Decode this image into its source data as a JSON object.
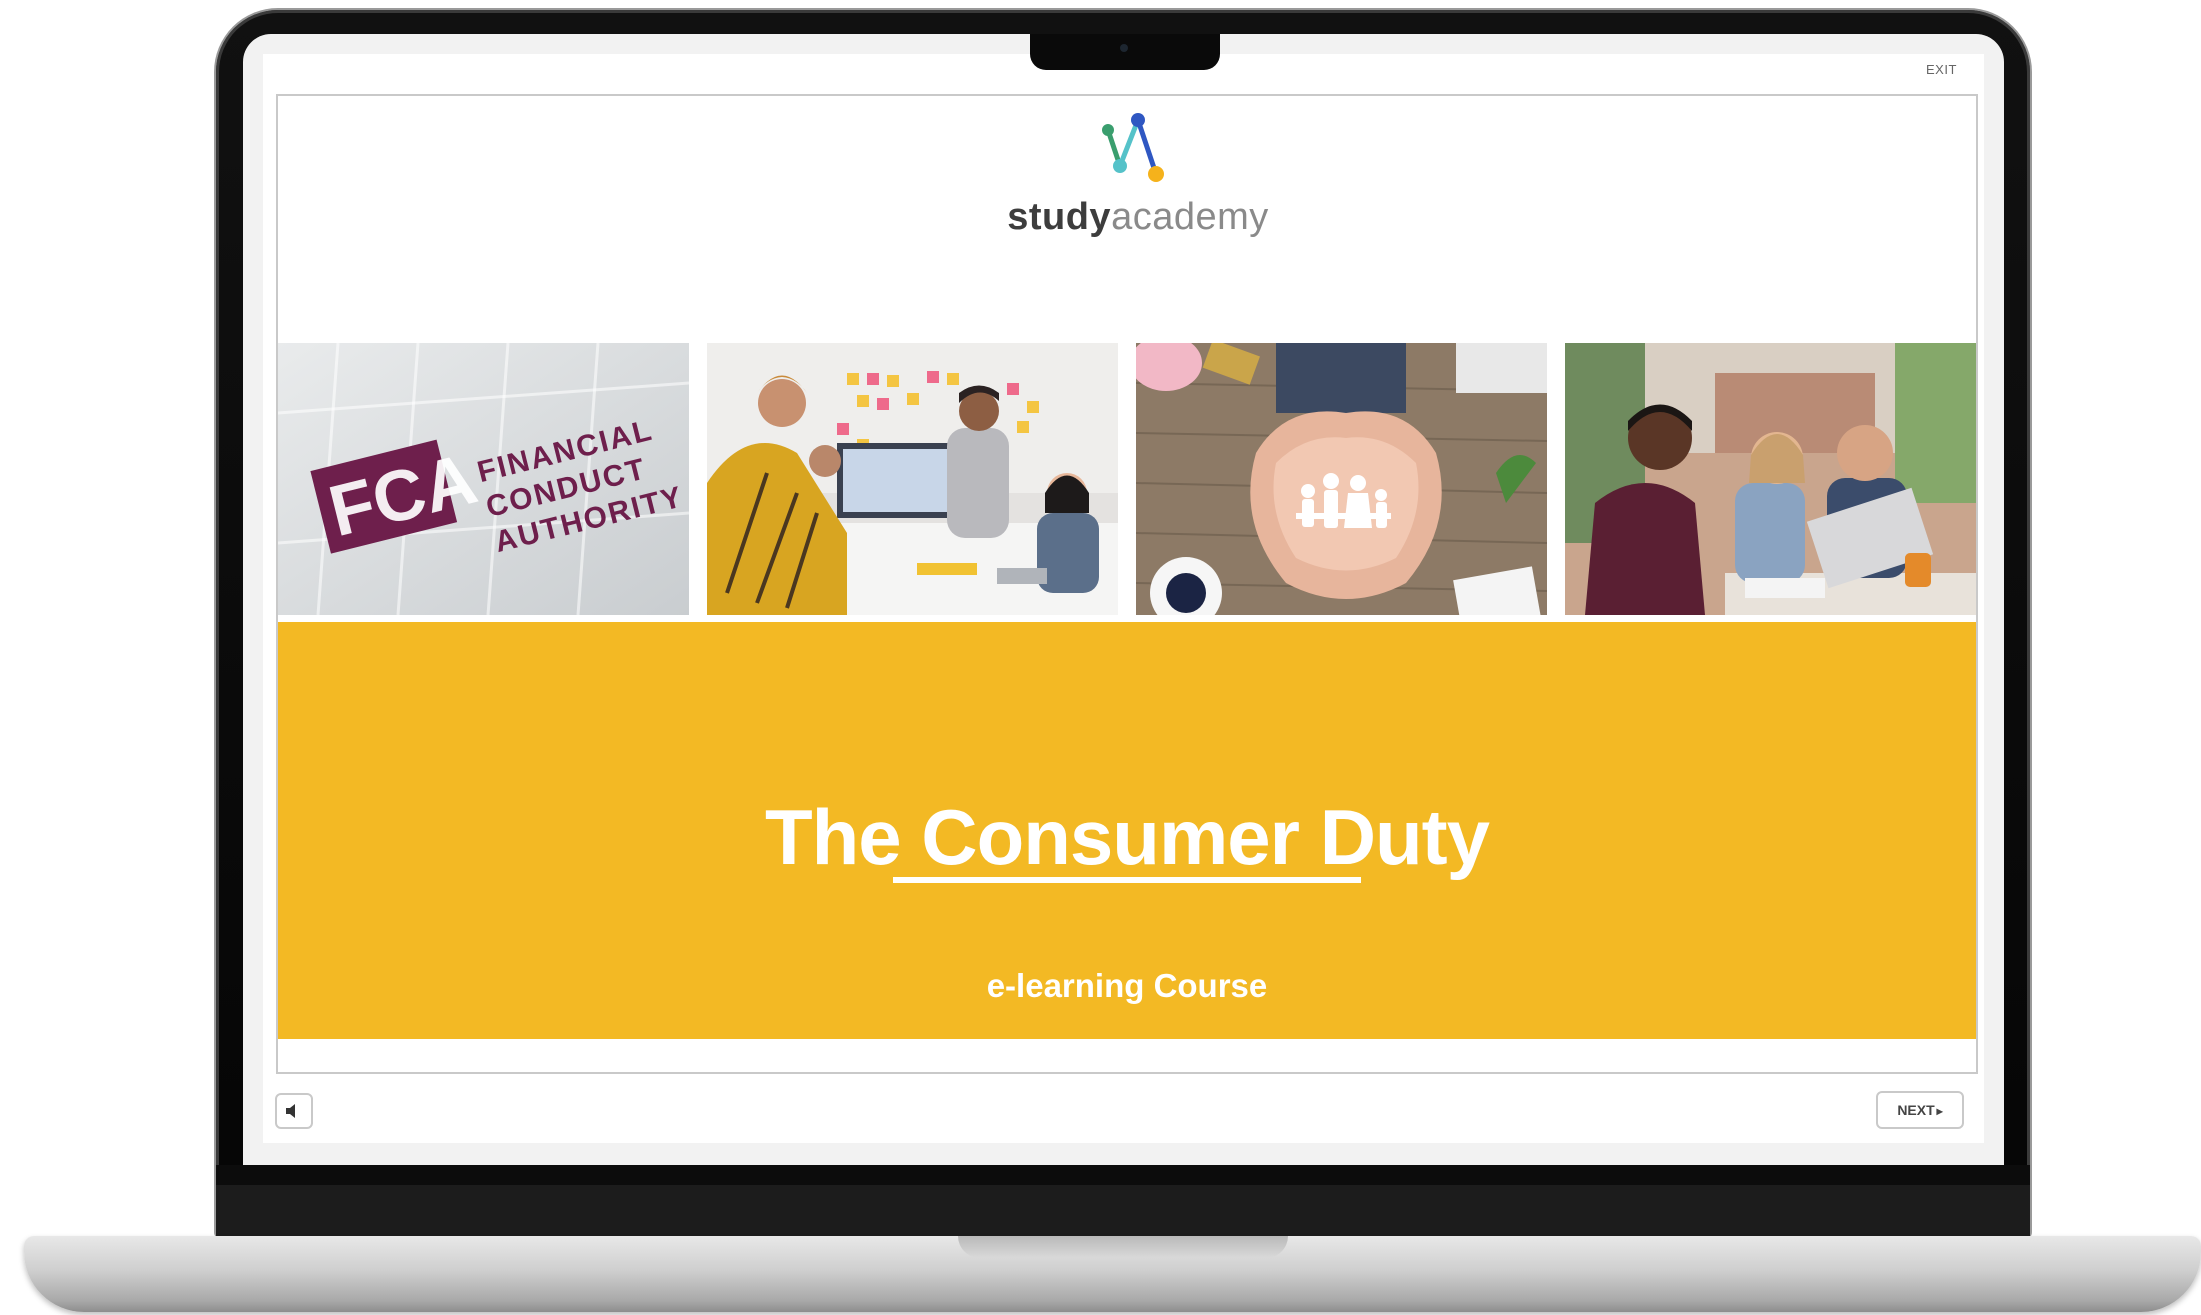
{
  "player": {
    "exit_label": "EXIT",
    "next_label": "NEXT",
    "next_icon": "chevron-right-icon",
    "audio_icon": "speaker-icon"
  },
  "logo": {
    "word_bold": "study",
    "word_light": "academy",
    "colors": [
      "#3a9e6e",
      "#55c2c9",
      "#2f57c2",
      "#f5b21b"
    ]
  },
  "photos": [
    {
      "name": "fca-sign-photo",
      "lines": [
        "FINANCIAL",
        "CONDUCT",
        "AUTHORITY"
      ],
      "mark": "FCA"
    },
    {
      "name": "office-meeting-photo"
    },
    {
      "name": "paper-family-hands-photo"
    },
    {
      "name": "colleagues-laptop-photo"
    }
  ],
  "slide": {
    "title": "The Consumer Duty",
    "subtitle": "e-learning Course",
    "banner_color": "#f3b924"
  }
}
